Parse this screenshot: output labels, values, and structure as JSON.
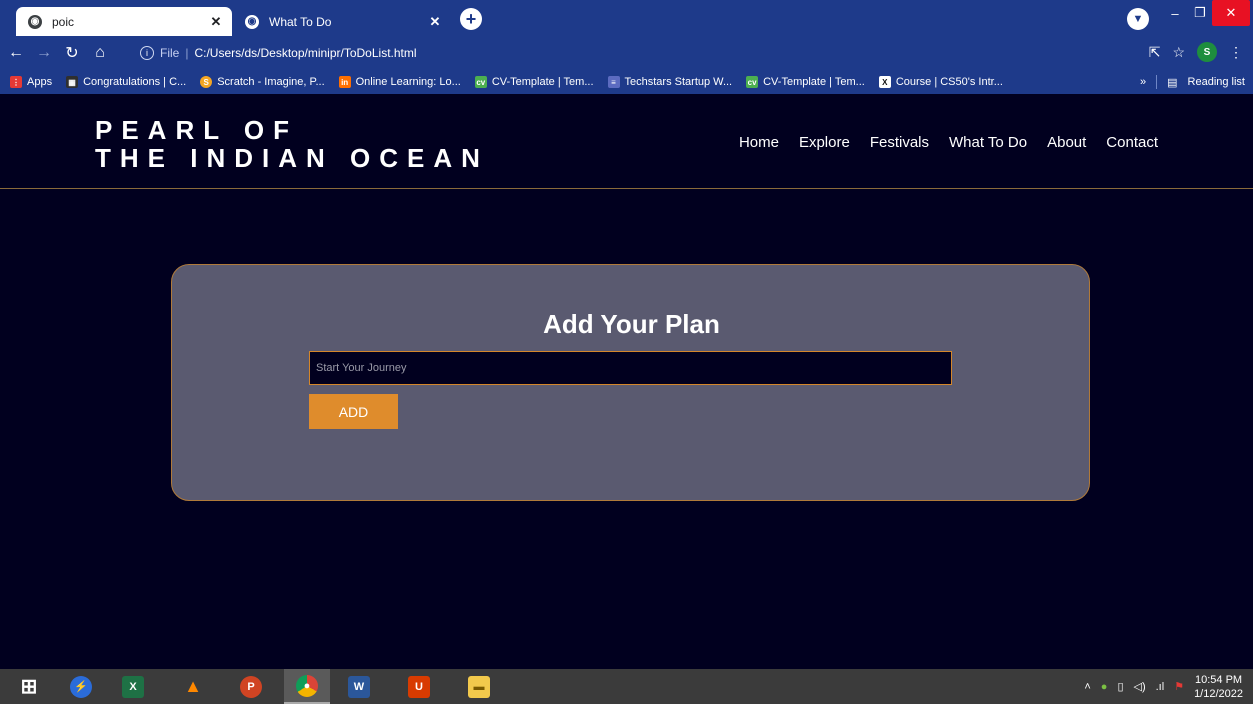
{
  "browser": {
    "tabs": [
      {
        "title": "poic",
        "active": false
      },
      {
        "title": "What To Do",
        "active": true
      }
    ],
    "address": {
      "scheme": "File",
      "url": "C:/Users/ds/Desktop/minipr/ToDoList.html"
    },
    "profile_initial": "S",
    "bookmarks": [
      {
        "label": "Apps",
        "icon_color": "#e53935"
      },
      {
        "label": "Congratulations | C...",
        "icon_color": "#2f2f2f"
      },
      {
        "label": "Scratch - Imagine, P...",
        "icon_color": "#f5a623"
      },
      {
        "label": "Online Learning: Lo...",
        "icon_color": "#ff6f00"
      },
      {
        "label": "CV-Template | Tem...",
        "icon_color": "#4caf50"
      },
      {
        "label": "Techstars Startup W...",
        "icon_color": "#5c6bc0"
      },
      {
        "label": "CV-Template | Tem...",
        "icon_color": "#4caf50"
      },
      {
        "label": "Course | CS50's Intr...",
        "icon_color": "#1e3a8a"
      }
    ],
    "bookmarks_overflow": "»",
    "reading_list": "Reading list"
  },
  "site": {
    "logo_line1": "PEARL OF",
    "logo_line2": "THE INDIAN OCEAN",
    "nav": [
      "Home",
      "Explore",
      "Festivals",
      "What To Do",
      "About",
      "Contact"
    ]
  },
  "planner": {
    "title": "Add Your Plan",
    "input_value": "",
    "input_placeholder": "Start Your Journey",
    "add_label": "ADD"
  },
  "taskbar": {
    "apps": [
      "windows-start",
      "edge-assistant",
      "excel",
      "vlc",
      "powerpoint",
      "chrome",
      "word",
      "office",
      "file-explorer"
    ],
    "time": "10:54 PM",
    "date": "1/12/2022"
  },
  "colors": {
    "page_bg": "#01001f",
    "card_bg": "#5a5a70",
    "accent": "#df8c2c",
    "browser_chrome": "#1e3a8a"
  }
}
